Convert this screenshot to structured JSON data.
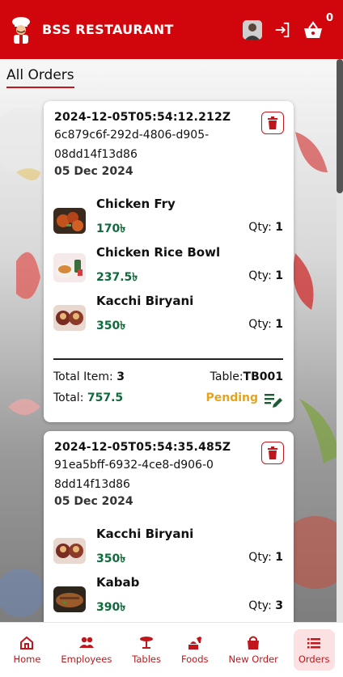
{
  "header": {
    "title": "BSS RESTAURANT",
    "cart_count": "0",
    "icons": [
      "chef-logo-icon",
      "avatar",
      "logout-icon",
      "basket-icon"
    ]
  },
  "page": {
    "title": "All Orders"
  },
  "orders": [
    {
      "timestamp": "2024-12-05T05:54:12.212Z",
      "id": "6c879c6f-292d-4806-d905-08dd14f13d86",
      "date": "05 Dec 2024",
      "items": [
        {
          "name": "Chicken Fry",
          "price": "170৳",
          "qty_label": "Qty:",
          "qty": "1"
        },
        {
          "name": "Chicken Rice Bowl",
          "price": "237.5৳",
          "qty_label": "Qty:",
          "qty": "1"
        },
        {
          "name": "Kacchi Biryani",
          "price": "350৳",
          "qty_label": "Qty:",
          "qty": "1"
        }
      ],
      "total_item_label": "Total Item:",
      "total_item": "3",
      "table_label": "Table:",
      "table": "TB001",
      "total_label": "Total:",
      "total": "757.5",
      "status": "Pending"
    },
    {
      "timestamp": "2024-12-05T05:54:35.485Z",
      "id": "91ea5bff-6932-4ce8-d906-08dd14f13d86",
      "date": "05 Dec 2024",
      "items": [
        {
          "name": "Kacchi Biryani",
          "price": "350৳",
          "qty_label": "Qty:",
          "qty": "1"
        },
        {
          "name": "Kabab",
          "price": "390৳",
          "qty_label": "Qty:",
          "qty": "3"
        }
      ]
    }
  ],
  "nav": [
    {
      "label": "Home",
      "icon": "home-icon"
    },
    {
      "label": "Employees",
      "icon": "people-icon"
    },
    {
      "label": "Tables",
      "icon": "table-icon"
    },
    {
      "label": "Foods",
      "icon": "food-icon"
    },
    {
      "label": "New Order",
      "icon": "shopping-bag-icon"
    },
    {
      "label": "Orders",
      "icon": "list-icon",
      "active": true
    }
  ],
  "colors": {
    "brand_red": "#d1060c",
    "price_green": "#0f6b3c",
    "pending_amber": "#e6a41a"
  }
}
